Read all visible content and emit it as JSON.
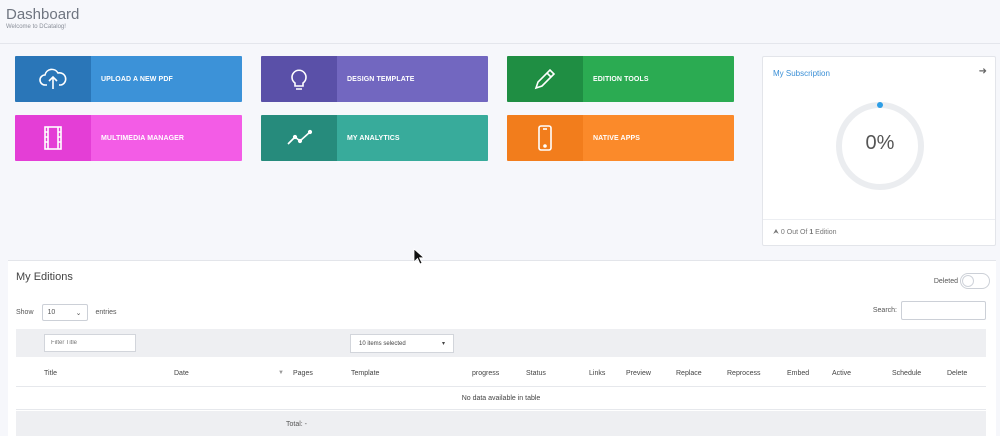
{
  "header": {
    "title": "Dashboard",
    "subtitle": "Welcome to DCatalog!"
  },
  "tiles": [
    {
      "label": "UPLOAD A NEW PDF",
      "icon": "cloud-upload-icon",
      "dark": "#2a76b8",
      "light": "#3c92d8"
    },
    {
      "label": "DESIGN TEMPLATE",
      "icon": "lightbulb-icon",
      "dark": "#5a50a8",
      "light": "#7267c0"
    },
    {
      "label": "EDITION TOOLS",
      "icon": "pencil-icon",
      "dark": "#1f8e43",
      "light": "#2bab52"
    },
    {
      "label": "MULTIMEDIA MANAGER",
      "icon": "film-icon",
      "dark": "#e43ed6",
      "light": "#f35ce6"
    },
    {
      "label": "MY ANALYTICS",
      "icon": "line-chart-icon",
      "dark": "#268b7c",
      "light": "#38ab9b"
    },
    {
      "label": "NATIVE APPS",
      "icon": "mobile-phone-icon",
      "dark": "#f27d1c",
      "light": "#fb8a2a"
    }
  ],
  "subscription": {
    "title": "My Subscription",
    "progress_percent": 0,
    "progress_text": "0%",
    "footer_prefix": "0 Out Of ",
    "footer_count": "1",
    "footer_suffix": " Edition"
  },
  "editions": {
    "title": "My Editions",
    "deleted_label": "Deleted",
    "show_label": "Show",
    "entries_value": "10",
    "entries_label": "entries",
    "search_label": "Search:",
    "filter_placeholder": "Filter Title",
    "items_selected": "10 items selected",
    "columns": [
      "Title",
      "Date",
      "Pages",
      "Template",
      "progress",
      "Status",
      "Links",
      "Preview",
      "Replace",
      "Reprocess",
      "Embed",
      "Active",
      "Schedule",
      "Delete"
    ],
    "empty_text": "No data available in table",
    "total_label": "Total: -"
  }
}
